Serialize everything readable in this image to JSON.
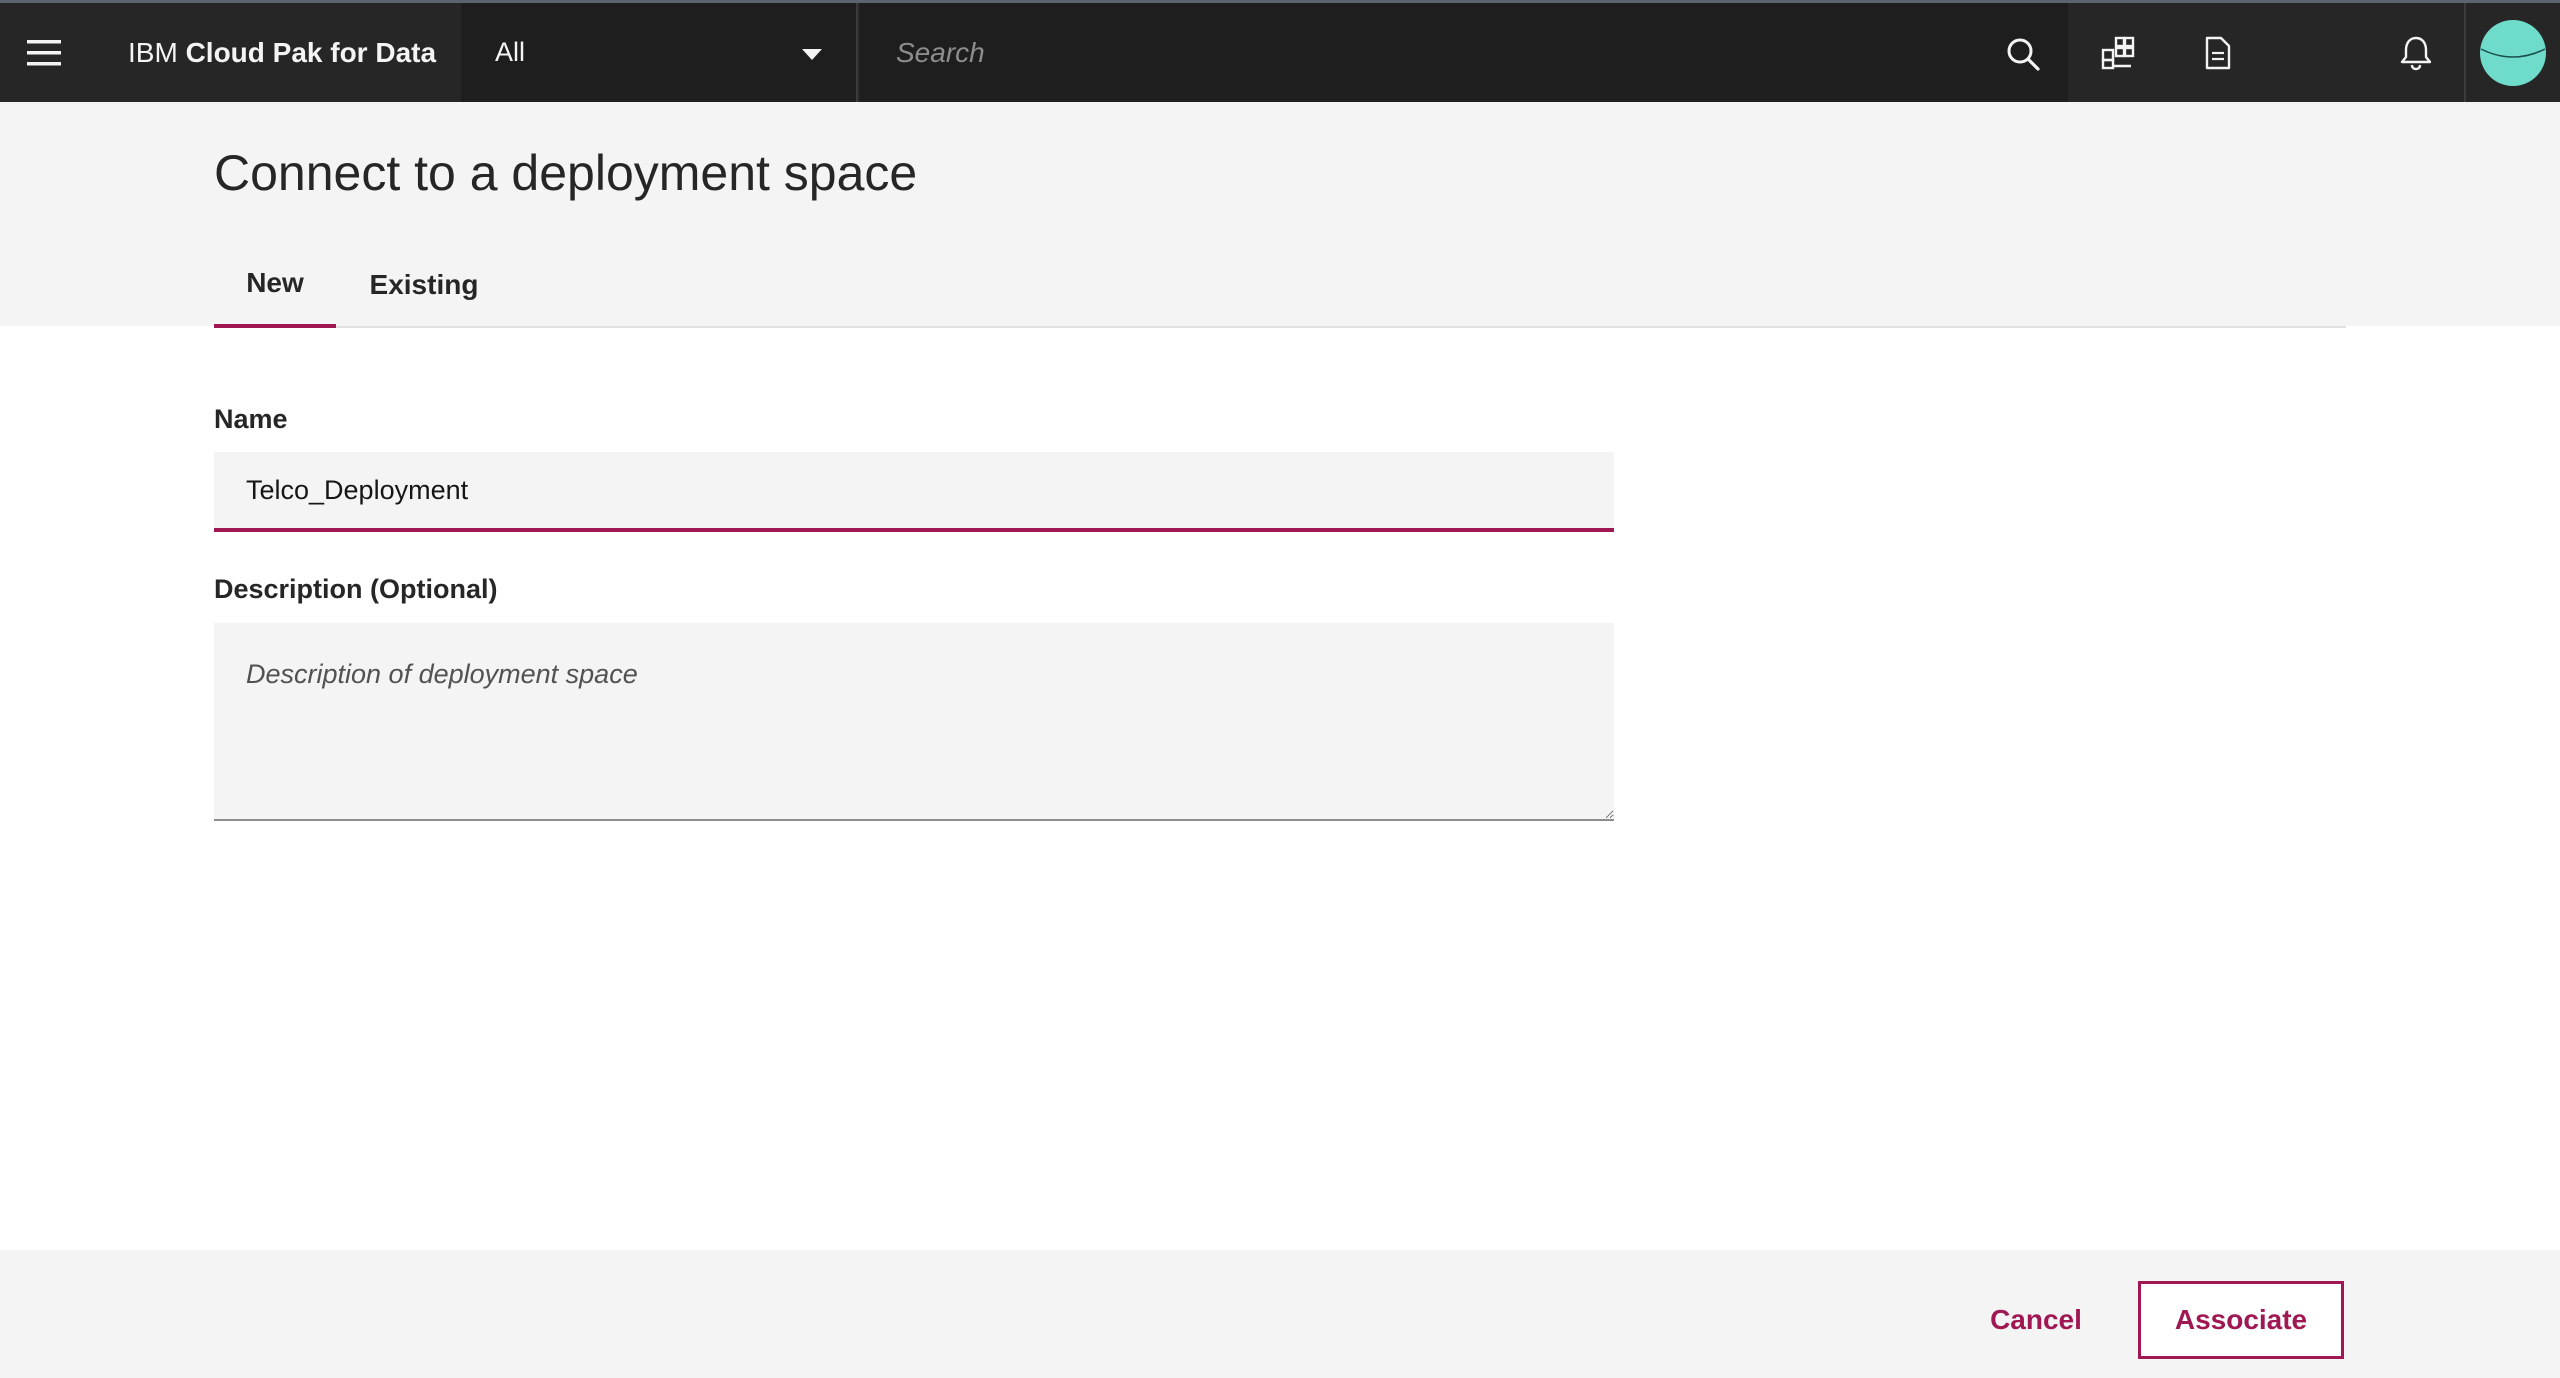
{
  "topbar": {
    "brand_prefix": "IBM",
    "brand_name": "Cloud Pak for Data",
    "scope_value": "All",
    "search_placeholder": "Search",
    "icons": [
      "menu-icon",
      "search-icon",
      "apps-icon",
      "document-icon",
      "notification-bell-icon",
      "avatar"
    ]
  },
  "page": {
    "title": "Connect to a deployment space",
    "tabs": [
      {
        "label": "New",
        "active": true
      },
      {
        "label": "Existing",
        "active": false
      }
    ]
  },
  "form": {
    "name_label": "Name",
    "name_value": "Telco_Deployment",
    "description_label": "Description (Optional)",
    "description_placeholder": "Description of deployment space",
    "description_value": ""
  },
  "footer": {
    "cancel_label": "Cancel",
    "associate_label": "Associate"
  },
  "colors": {
    "accent": "#9f1853",
    "topbar_bg": "#262626",
    "avatar": "#6fdccb"
  }
}
